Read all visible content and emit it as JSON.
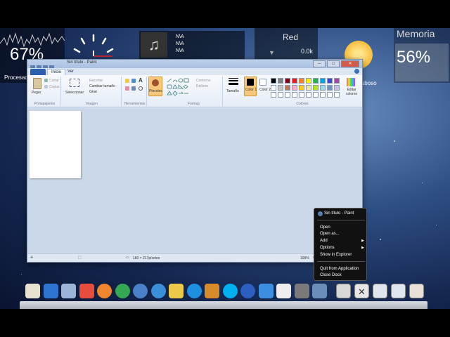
{
  "widgets": {
    "cpu": {
      "percent": "67%",
      "label": "Procesador"
    },
    "music": {
      "line1": "N\\A",
      "line2": "N\\A",
      "line3": "N\\A"
    },
    "network": {
      "title": "Red",
      "value": "0.0k"
    },
    "weather": {
      "label": "Nuboso"
    },
    "memory": {
      "title": "Memoria",
      "percent": "56%"
    }
  },
  "paint": {
    "title": "Sin título - Paint",
    "tabs": {
      "home": "Inicio",
      "view": "Ver"
    },
    "clipboard": {
      "paste": "Pegar",
      "cut": "Cortar",
      "copy": "Copiar",
      "group": "Portapapeles"
    },
    "image": {
      "select": "Seleccionar",
      "crop": "Recortar",
      "resize": "Cambiar tamaño",
      "rotate": "Girar",
      "group": "Imagen"
    },
    "tools": {
      "group": "Herramientas"
    },
    "brushes": {
      "label": "Pinceles"
    },
    "shapes": {
      "outline": "Contorno",
      "fill": "Relleno",
      "group": "Formas"
    },
    "size": {
      "label": "Tamaño"
    },
    "colors": {
      "color1": "Color 1",
      "color2": "Color 2",
      "edit": "Editar colores",
      "group": "Colores"
    },
    "status": {
      "dimensions": "160 × 217píxeles",
      "zoom": "100%"
    }
  },
  "context_menu": {
    "header": "Sin título - Paint",
    "items": [
      "Open",
      "Open as...",
      "Add",
      "Options",
      "Show in Explorer",
      "Quit from Application",
      "Close Dock"
    ]
  },
  "colors": {
    "palette": [
      "#000000",
      "#7f7f7f",
      "#880015",
      "#ed1c24",
      "#ff7f27",
      "#fff200",
      "#22b14c",
      "#00a2e8",
      "#3f48cc",
      "#a349a4",
      "#ffffff",
      "#c3c3c3",
      "#b97a57",
      "#ffaec9",
      "#ffc90e",
      "#efe4b0",
      "#b5e61d",
      "#99d9ea",
      "#7092be",
      "#c8bfe7"
    ],
    "dock_icons": [
      "#e7e1d0",
      "#2f74d0",
      "#9cb4d8",
      "#e74c3c",
      "#f0852d",
      "#34a853",
      "#4a7fc9",
      "#3a8fd8",
      "#e9c84a",
      "#1f8fe0",
      "#d98a2a",
      "#00aff0",
      "#2d5fc0",
      "#3c8fe0",
      "#eeeeee",
      "#7a7a7a",
      "#6b8db8"
    ]
  },
  "dock": {
    "icons": [
      "home-icon",
      "itunes-icon",
      "mail-icon",
      "picasa-icon",
      "firefox-icon",
      "chrome-icon",
      "safari-icon",
      "network-icon",
      "notes-icon",
      "ie-icon",
      "gallery-icon",
      "skype-icon",
      "media-player-icon",
      "chat-icon",
      "skull-icon",
      "trash-icon",
      "paint-icon"
    ]
  }
}
